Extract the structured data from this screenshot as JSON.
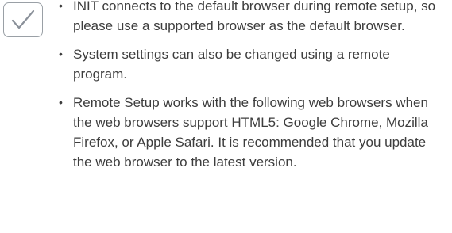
{
  "icon": "check-icon",
  "bullets": [
    "INIT connects to the default browser during remote setup, so please use a supported browser as the default browser.",
    "System settings can also be changed using a remote program.",
    "Remote Setup works with the following web browsers when the web browsers support HTML5: Google Chrome, Mozilla Firefox, or Apple Safari. It is recommended that you update the web browser to the latest version."
  ]
}
